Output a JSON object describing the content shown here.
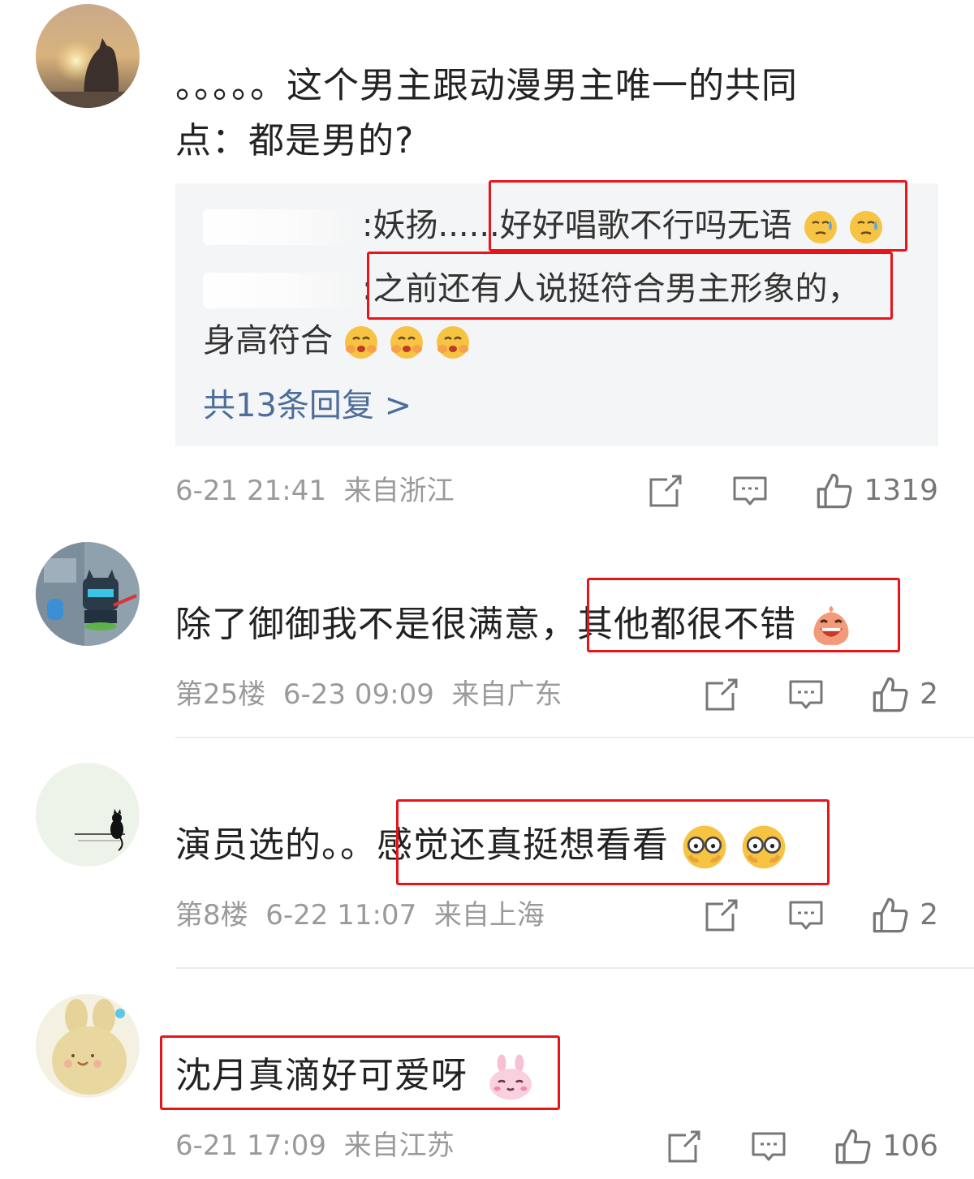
{
  "comments": [
    {
      "text_line1": "。。。。。这个男主跟动漫男主唯一的共同",
      "text_line2": "点：都是男的?",
      "replies": [
        {
          "prefix": ":",
          "text": "妖扬......好好唱歌不行吗无语"
        },
        {
          "prefix": ":",
          "text": "之前还有人说挺符合男主形象的，"
        },
        {
          "text": "身高符合"
        }
      ],
      "more_replies": "共13条回复 >",
      "meta": "6-21 21:41  来自浙江",
      "likes": "1319"
    },
    {
      "text": "除了御御我不是很满意，其他都很不错",
      "meta": "第25楼  6-23 09:09  来自广东",
      "likes": "2"
    },
    {
      "text": "演员选的。。感觉还真挺想看看",
      "meta": "第8楼  6-22 11:07  来自上海",
      "likes": "2"
    },
    {
      "text": "沈月真滴好可爱呀",
      "meta": "6-21 17:09  来自江苏",
      "likes": "106"
    }
  ],
  "icons": {
    "share": "share-icon",
    "comment": "comment-icon",
    "like": "thumbs-up-icon",
    "emoji_sweat": "sweat-emoji",
    "emoji_blush": "blush-emoji",
    "emoji_laugh": "laugh-emoji",
    "emoji_glasses": "glasses-emoji",
    "emoji_bunny": "bunny-emoji"
  },
  "colors": {
    "highlight": "#e8141a",
    "link": "#4d6d9a",
    "meta": "#9a9a9a",
    "reply_bg": "#f4f5f6"
  }
}
